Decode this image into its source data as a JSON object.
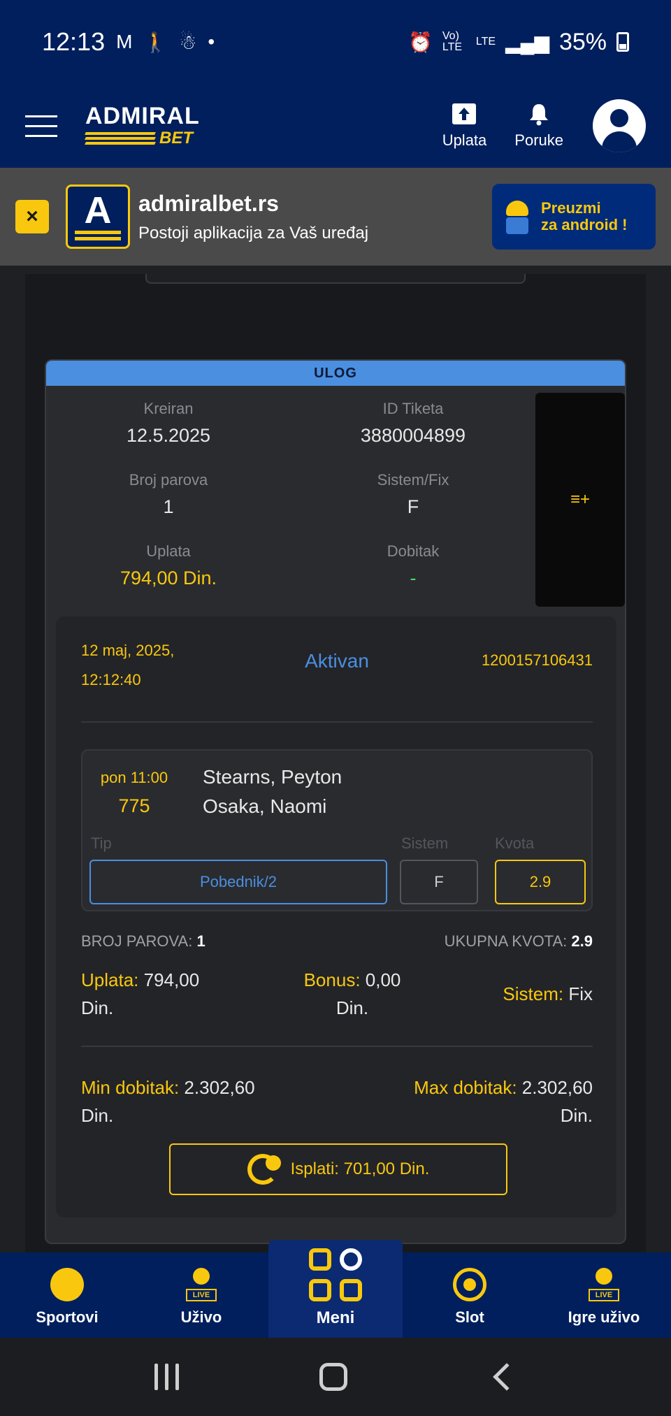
{
  "status_bar": {
    "time": "12:13",
    "left_icons": [
      "gmail-icon",
      "walking-icon",
      "activity-icon",
      "dot-icon"
    ],
    "volte": "Vo) LTE",
    "lte": "LTE",
    "battery_percent": "35%"
  },
  "header": {
    "logo_top": "ADMIRAL",
    "logo_bottom": "BET",
    "uplata_label": "Uplata",
    "poruke_label": "Poruke"
  },
  "app_banner": {
    "close_label": "×",
    "app_icon_letter": "A",
    "title": "admiralbet.rs",
    "subtitle": "Postoji aplikacija za Vaš uređaj",
    "download_line1": "Preuzmi",
    "download_line2": "za android !"
  },
  "ticket": {
    "header_label": "ULOG",
    "kreiran_label": "Kreiran",
    "kreiran_value": "12.5.2025",
    "id_label": "ID Tiketa",
    "id_value": "3880004899",
    "broj_parova_label": "Broj parova",
    "broj_parova_value": "1",
    "sistem_label": "Sistem/Fix",
    "sistem_value": "F",
    "uplata_label": "Uplata",
    "uplata_value": "794,00 Din.",
    "dobitak_label": "Dobitak",
    "dobitak_value": "-"
  },
  "bet": {
    "date_line1": "12 maj, 2025,",
    "date_line2": "12:12:40",
    "status": "Aktivan",
    "bet_id": "1200157106431",
    "match_time": "pon 11:00",
    "match_code": "775",
    "team_home": "Stearns, Peyton",
    "team_away": "Osaka, Naomi",
    "tip_label": "Tip",
    "sistem_col_label": "Sistem",
    "kvota_label": "Kvota",
    "tip_value": "Pobednik/2",
    "sistem_value": "F",
    "kvota_value": "2.9",
    "broj_parova_label": "BROJ PAROVA:",
    "broj_parova_value": "1",
    "ukupna_kvota_label": "UKUPNA KVOTA:",
    "ukupna_kvota_value": "2.9",
    "uplata_label": "Uplata:",
    "uplata_value": "794,00",
    "bonus_label": "Bonus:",
    "bonus_value": "0,00",
    "din": "Din.",
    "sistem_label": "Sistem:",
    "sistem_text": "Fix",
    "min_label": "Min dobitak:",
    "min_value": "2.302,60",
    "max_label": "Max dobitak:",
    "max_value": "2.302,60",
    "payout_label": "Isplati: 701,00 Din."
  },
  "bottom_nav": {
    "sportovi": "Sportovi",
    "uzivo": "Uživo",
    "meni": "Meni",
    "slot": "Slot",
    "igre_uzivo": "Igre uživo",
    "live_badge": "LIVE"
  },
  "colors": {
    "navy": "#001f5c",
    "yellow": "#f9c80e",
    "blue": "#4a8fe0",
    "green": "#4cd964"
  }
}
